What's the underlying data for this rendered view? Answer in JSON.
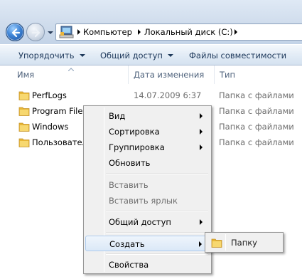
{
  "address_bar": {
    "back_icon": "back-arrow-icon",
    "forward_icon": "forward-arrow-icon",
    "breadcrumbs": [
      "Компьютер",
      "Локальный диск (C:)"
    ]
  },
  "command_bar": {
    "organize": "Упорядочить",
    "share": "Общий доступ",
    "compat_files": "Файлы совместимости"
  },
  "columns": {
    "name": "Имя",
    "modified": "Дата изменения",
    "type": "Тип"
  },
  "files": [
    {
      "name": "PerfLogs",
      "modified": "14.07.2009 6:37",
      "type": "Папка с файлами"
    },
    {
      "name": "Program Files",
      "modified": "",
      "type": "Папка с файлами"
    },
    {
      "name": "Windows",
      "modified": "",
      "type": "Папка с файлами"
    },
    {
      "name": "Пользовател",
      "modified": "",
      "type": "Папка с файлами"
    }
  ],
  "context_menu": {
    "view": "Вид",
    "sort": "Сортировка",
    "group": "Группировка",
    "refresh": "Обновить",
    "paste": "Вставить",
    "paste_shortcut": "Вставить ярлык",
    "share": "Общий доступ",
    "create": "Создать",
    "properties": "Свойства"
  },
  "submenu": {
    "folder": "Папку"
  },
  "colors": {
    "folder": "#f2c64a",
    "hover_border": "#aeccee",
    "menu_bg": "#f0f0f0"
  }
}
